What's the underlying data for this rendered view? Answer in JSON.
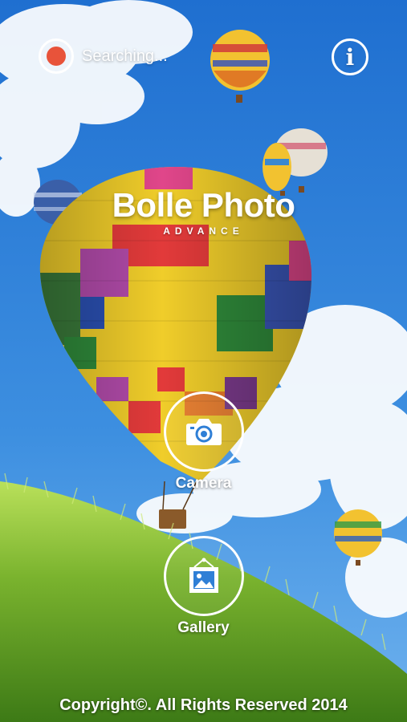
{
  "status": {
    "text": "Searching...",
    "indicator_color": "#e8533a"
  },
  "info_button": {
    "icon": "info-icon",
    "glyph": "i"
  },
  "logo": {
    "title": "Bolle Photo",
    "subtitle": "ADVANCE"
  },
  "actions": [
    {
      "label": "Camera",
      "icon": "camera-icon"
    },
    {
      "label": "Gallery",
      "icon": "gallery-icon"
    }
  ],
  "footer": {
    "copyright": "Copyright©. All Rights Reserved 2014"
  },
  "colors": {
    "sky": "#2f7fd6",
    "grass": "#7ab32e",
    "foreground": "#ffffff"
  }
}
